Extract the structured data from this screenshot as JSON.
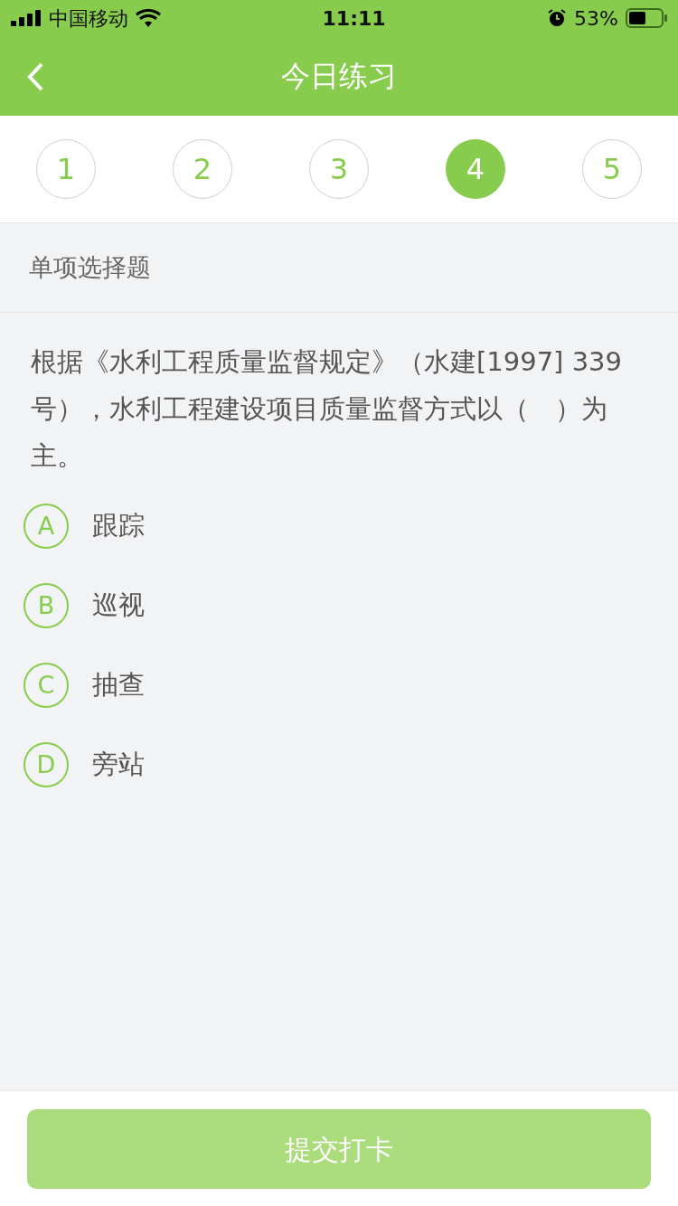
{
  "status_bar": {
    "carrier": "中国移动",
    "time": "11:11",
    "battery": "53%"
  },
  "nav": {
    "title": "今日练习"
  },
  "steps": [
    {
      "label": "1",
      "selected": false
    },
    {
      "label": "2",
      "selected": false
    },
    {
      "label": "3",
      "selected": false
    },
    {
      "label": "4",
      "selected": true
    },
    {
      "label": "5",
      "selected": false
    }
  ],
  "question_type": "单项选择题",
  "question": "根据《水利工程质量监督规定》（水建[1997] 339号），水利工程建设项目质量监督方式以（　）为主。",
  "options": [
    {
      "letter": "A",
      "text": "跟踪",
      "selected": false
    },
    {
      "letter": "B",
      "text": "巡视",
      "selected": false
    },
    {
      "letter": "C",
      "text": "抽查",
      "selected": false
    },
    {
      "letter": "D",
      "text": "旁站",
      "selected": false
    }
  ],
  "submit": {
    "label": "提交打卡",
    "disabled": true
  }
}
